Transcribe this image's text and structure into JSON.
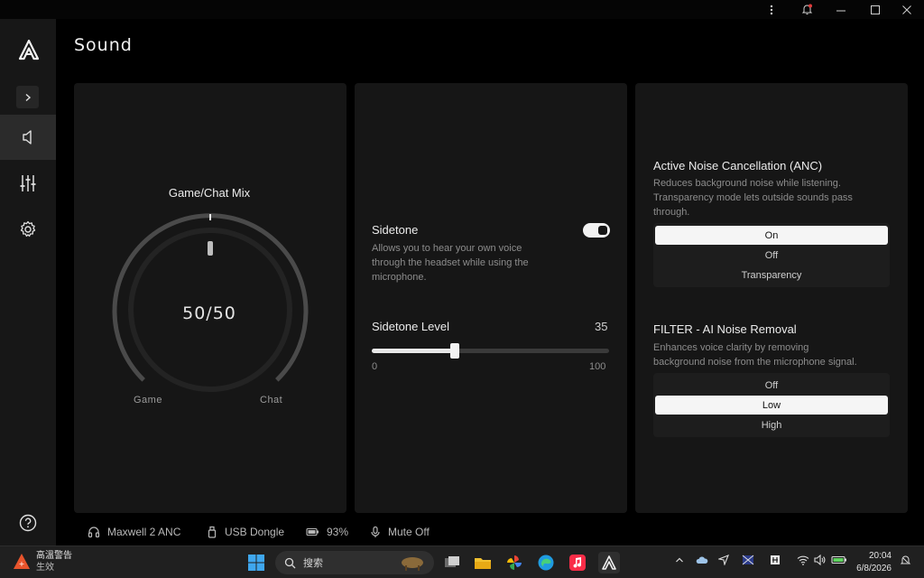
{
  "titlebar": {
    "more_icon": "more-vertical-icon",
    "bell_icon": "notification-bell-icon",
    "minimize_icon": "minimize-icon",
    "maximize_icon": "maximize-icon",
    "close_icon": "close-icon"
  },
  "sidebar": {
    "items": [
      {
        "name": "sound",
        "icon": "speaker-icon",
        "active": true
      },
      {
        "name": "equalizer",
        "icon": "sliders-icon",
        "active": false
      },
      {
        "name": "settings",
        "icon": "gear-icon",
        "active": false
      }
    ],
    "help_icon": "help-circle-icon"
  },
  "page": {
    "title": "Sound"
  },
  "mix": {
    "title": "Game/Chat Mix",
    "value_label": "50/50",
    "mix_fraction": 0.5,
    "left_label": "Game",
    "right_label": "Chat"
  },
  "sidetone": {
    "title": "Sidetone",
    "description_lines": [
      "Allows you to hear your own voice",
      "through the headset while using the",
      "microphone."
    ],
    "enabled": true,
    "level_label": "Sidetone Level",
    "level_value": "35",
    "level": 35,
    "min_label": "0",
    "max_label": "100",
    "max": 100
  },
  "anc": {
    "title": "Active Noise Cancellation (ANC)",
    "description_lines": [
      "Reduces background noise while listening.",
      "Transparency mode lets outside sounds pass",
      "through."
    ],
    "options": [
      "On",
      "Off",
      "Transparency"
    ],
    "selected": "On"
  },
  "filter": {
    "title": "FILTER - AI Noise Removal",
    "description_lines": [
      "Enhances voice clarity by removing",
      "background noise from the microphone signal."
    ],
    "options": [
      "Off",
      "Low",
      "High"
    ],
    "selected": "Low"
  },
  "status": {
    "device": "Maxwell 2 ANC",
    "connection": "USB Dongle",
    "battery": "93%",
    "mute": "Mute Off"
  },
  "taskbar": {
    "weather_title": "高溫警告",
    "weather_sub": "生效",
    "search_placeholder": "搜索",
    "time": "20:04",
    "date": "6/8/2026",
    "colors": {
      "edge": "#1f9be0",
      "music": "#fa2d48",
      "files": "#f2c130",
      "alert": "#e8542c"
    }
  }
}
